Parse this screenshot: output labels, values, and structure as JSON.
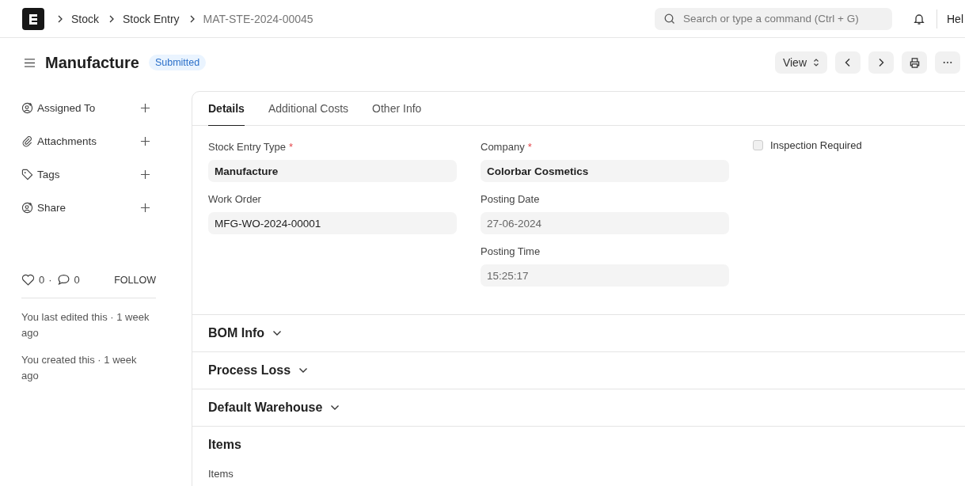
{
  "navbar": {
    "breadcrumbs": [
      "Stock",
      "Stock Entry",
      "MAT-STE-2024-00045"
    ],
    "search": {
      "placeholder": "Search or type a command (Ctrl + G)"
    },
    "user_menu": "Hel"
  },
  "header": {
    "title": "Manufacture",
    "status": "Submitted",
    "view_button": "View"
  },
  "sidebar": {
    "items": [
      {
        "label": "Assigned To",
        "kind": "user"
      },
      {
        "label": "Attachments",
        "kind": "clip"
      },
      {
        "label": "Tags",
        "kind": "tag"
      },
      {
        "label": "Share",
        "kind": "user"
      }
    ],
    "likes": "0",
    "separator": "·",
    "comments": "0",
    "follow": "FOLLOW",
    "activity": [
      "You last edited this · 1 week ago",
      "You created this · 1 week ago"
    ]
  },
  "tabs": [
    {
      "label": "Details",
      "selected": true
    },
    {
      "label": "Additional Costs",
      "selected": false
    },
    {
      "label": "Other Info",
      "selected": false
    }
  ],
  "columns": [
    [
      {
        "label": "Stock Entry Type",
        "required_mark": "*",
        "value": "Manufacture",
        "kind": "link"
      },
      {
        "label": "Work Order",
        "value": "MFG-WO-2024-00001",
        "kind": "data"
      }
    ],
    [
      {
        "label": "Company",
        "required_mark": "*",
        "value": "Colorbar Cosmetics",
        "kind": "link"
      },
      {
        "label": "Posting Date",
        "value": "27-06-2024",
        "kind": "readonly"
      },
      {
        "label": "Posting Time",
        "value": "15:25:17",
        "kind": "readonly"
      }
    ],
    [
      {
        "label": "Inspection Required",
        "checked": false,
        "kind": "check"
      }
    ]
  ],
  "sections": [
    {
      "title": "BOM Info",
      "collapsible": true
    },
    {
      "title": "Process Loss",
      "collapsible": true
    },
    {
      "title": "Default Warehouse",
      "collapsible": true
    },
    {
      "title": "Items",
      "collapsible": false,
      "sublabel": "Items"
    }
  ]
}
